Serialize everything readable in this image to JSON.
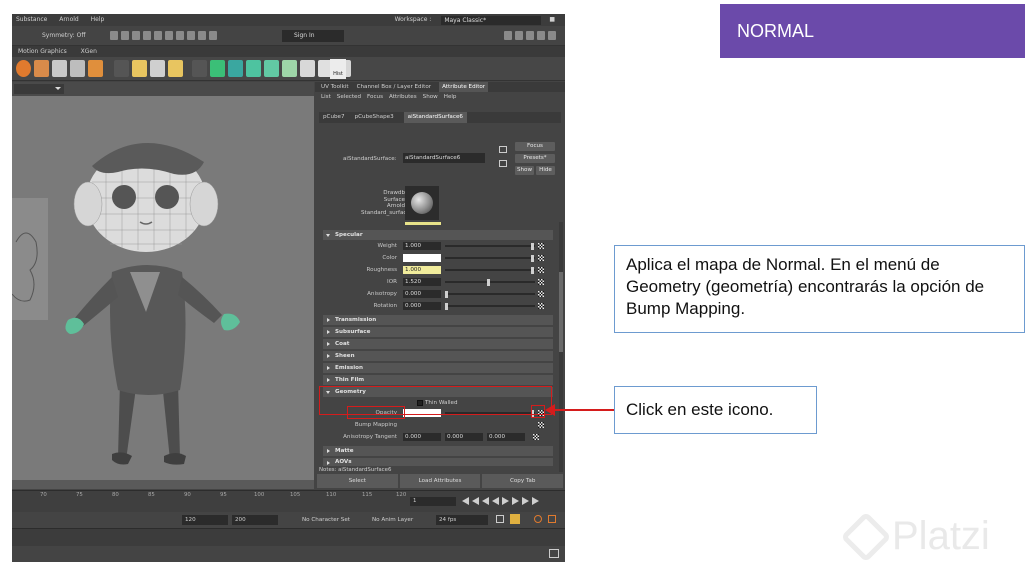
{
  "maya": {
    "menu": [
      "Substance",
      "Arnold",
      "Help"
    ],
    "workspace_label": "Workspace :",
    "workspace_value": "Maya Classic*",
    "symmetry": "Symmetry: Off",
    "sign_in": "Sign In",
    "shelf_tabs": [
      "Motion Graphics",
      "XGen"
    ],
    "history_label": "Hist"
  },
  "attribute_editor": {
    "panel_tabs": [
      "UV Toolkit",
      "Channel Box / Layer Editor",
      "Attribute Editor"
    ],
    "menu": [
      "List",
      "Selected",
      "Focus",
      "Attributes",
      "Show",
      "Help"
    ],
    "node_tabs": [
      "pCube7",
      "pCubeShape3",
      "aiStandardSurface6"
    ],
    "surface_label": "aiStandardSurface:",
    "surface_value": "aiStandardSurface6",
    "focus_btn": "Focus",
    "presets_btn": "Presets*",
    "show_btn": "Show",
    "hide_btn": "Hide",
    "swatch_label": [
      "Drawdb",
      "Surface",
      "Arnold",
      "Standard_surface"
    ],
    "specular_section": "Specular",
    "specular_attrs": [
      {
        "label": "Weight",
        "value": "1.000"
      },
      {
        "label": "Color",
        "value": ""
      },
      {
        "label": "Roughness",
        "value": "1.000"
      },
      {
        "label": "IOR",
        "value": "1.520"
      },
      {
        "label": "Anisotropy",
        "value": "0.000"
      },
      {
        "label": "Rotation",
        "value": "0.000"
      }
    ],
    "collapsed_sections": [
      "Transmission",
      "Subsurface",
      "Coat",
      "Sheen",
      "Emission",
      "Thin Film"
    ],
    "geometry_section": "Geometry",
    "thin_walled": "Thin Walled",
    "opacity_label": "Opacity",
    "bump_label": "Bump Mapping",
    "aniso_tangent_label": "Anisotropy Tangent",
    "aniso_tangent_values": [
      "0.000",
      "0.000",
      "0.000"
    ],
    "matte_section": "Matte",
    "aovs_section": "AOVs",
    "notes": "Notes: aiStandardSurface6",
    "bottom_buttons": [
      "Select",
      "Load Attributes",
      "Copy Tab"
    ]
  },
  "timeline": {
    "ticks": [
      "70",
      "75",
      "80",
      "85",
      "90",
      "95",
      "100",
      "105",
      "110",
      "115",
      "120"
    ],
    "current_frame": "1",
    "range_end": "120",
    "range_max": "200",
    "char_set": "No Character Set",
    "anim_layer": "No Anim Layer",
    "fps": "24 fps"
  },
  "slide": {
    "badge": "NORMAL",
    "note_geometry": "Aplica el mapa de Normal. En el menú de Geometry (geometría) encontrarás la opción de Bump Mapping.",
    "note_icon": "Click en este icono.",
    "watermark": "Platzi",
    "highlight_color": "#d51c1c",
    "badge_color": "#6b4aaa"
  }
}
